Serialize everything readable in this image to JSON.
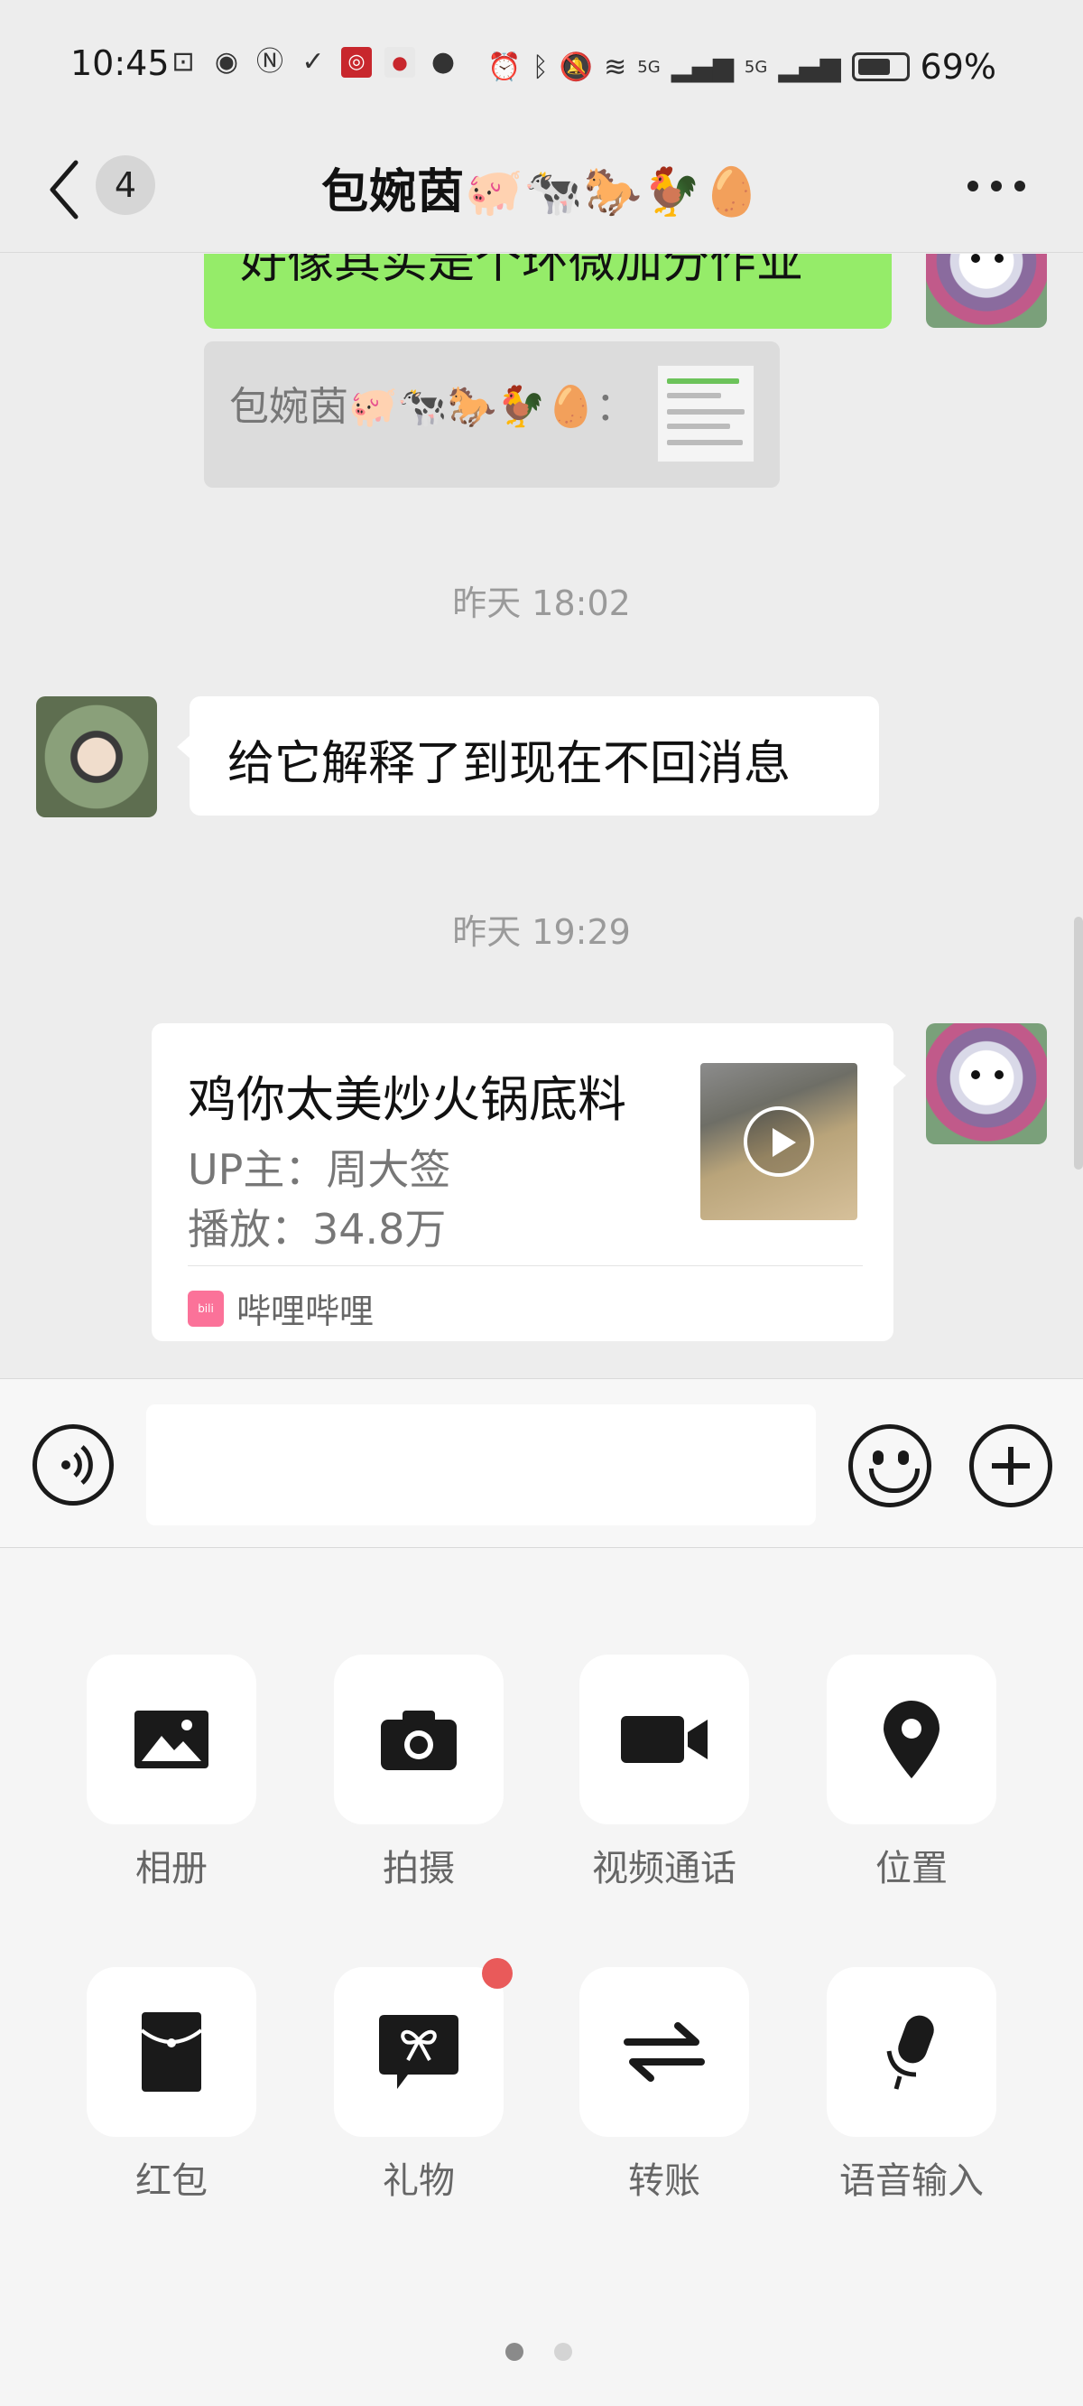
{
  "status_bar": {
    "time": "10:45",
    "battery_level": "69%",
    "battery_fraction": 0.69,
    "signal_labels": [
      "5G",
      "5G"
    ],
    "icons_left": [
      "cast-icon",
      "eye-icon",
      "nfc-icon",
      "pay-icon",
      "bank-icon",
      "app-icon",
      "chat-bubble-icon"
    ],
    "icons_right": [
      "alarm-icon",
      "bluetooth-icon",
      "mute-icon",
      "wifi-icon",
      "signal-icon",
      "signal-icon",
      "battery-icon"
    ]
  },
  "header": {
    "back_badge": "4",
    "title": "包婉茵🐖🐄🐎🐓🥚",
    "more_icon": "more-icon"
  },
  "messages": {
    "self_partial": "好像其实是个环微加分作业",
    "quote_text": "包婉茵🐖🐄🐎🐓🥚：",
    "timestamp_1": "昨天 18:02",
    "other_text": "给它解释了到现在不回消息",
    "timestamp_2": "昨天 19:29",
    "card": {
      "title": "鸡你太美炒火锅底料",
      "uploader": "UP主：周大签",
      "plays": "播放：34.8万",
      "source": "哔哩哔哩",
      "source_logo": "bilibili"
    }
  },
  "input": {
    "value": "",
    "placeholder": ""
  },
  "panel": {
    "items": [
      {
        "label": "相册",
        "icon": "photo-album-icon"
      },
      {
        "label": "拍摄",
        "icon": "camera-icon"
      },
      {
        "label": "视频通话",
        "icon": "video-call-icon"
      },
      {
        "label": "位置",
        "icon": "location-pin-icon"
      },
      {
        "label": "红包",
        "icon": "red-packet-icon"
      },
      {
        "label": "礼物",
        "icon": "gift-icon"
      },
      {
        "label": "转账",
        "icon": "transfer-icon"
      },
      {
        "label": "语音输入",
        "icon": "microphone-icon"
      }
    ],
    "page_count": 2,
    "current_page": 1
  },
  "colors": {
    "background": "#ededed",
    "self_bubble": "#95ec69",
    "panel_bg": "#f5f5f5",
    "badge_red": "#e95a5a",
    "bilibili_pink": "#fb7299"
  }
}
